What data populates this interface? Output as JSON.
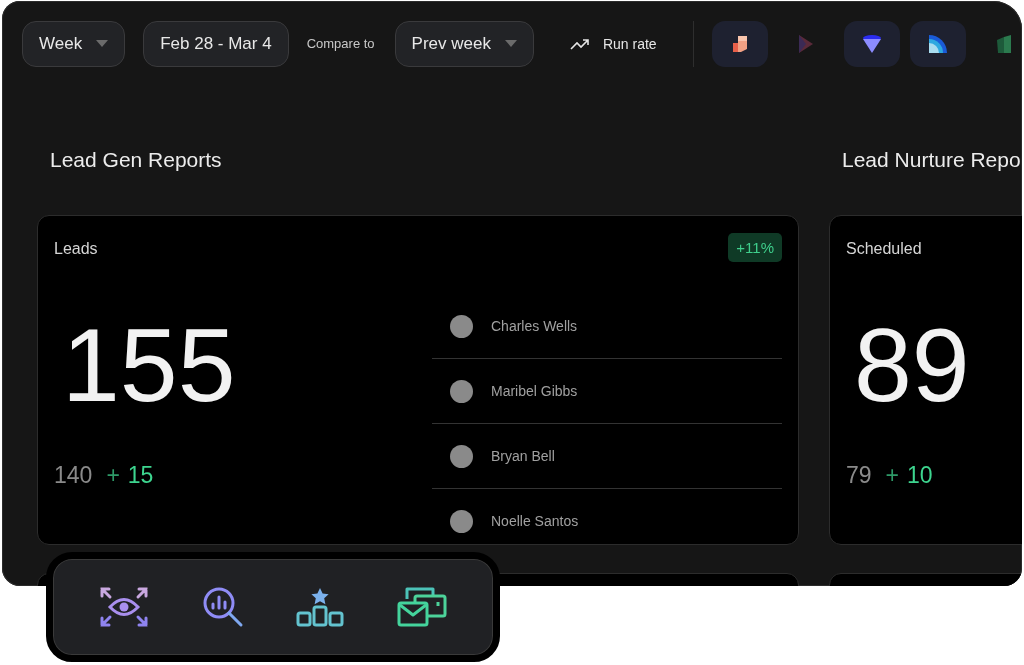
{
  "filters": {
    "period": "Week",
    "date_range": "Feb 28 - Mar 4",
    "compare_label": "Compare to",
    "compare": "Prev week",
    "run_rate": "Run rate"
  },
  "integrations": [
    {
      "kind": "blocks",
      "highlighted": true
    },
    {
      "kind": "chevron",
      "highlighted": false
    },
    {
      "kind": "funnel",
      "highlighted": true
    },
    {
      "kind": "arc",
      "highlighted": true
    },
    {
      "kind": "bars",
      "highlighted": false
    }
  ],
  "sections": [
    {
      "title": "Lead Gen Reports",
      "cards": [
        {
          "label": "Leads",
          "value": "155",
          "previous": "140",
          "delta_sign": "+",
          "delta": "15",
          "badge": "+11%",
          "people": [
            {
              "name": "Charles Wells"
            },
            {
              "name": "Maribel Gibbs"
            },
            {
              "name": "Bryan Bell"
            },
            {
              "name": "Noelle Santos"
            }
          ]
        }
      ]
    },
    {
      "title": "Lead Nurture Repo",
      "cards": [
        {
          "label": "Scheduled",
          "value": "89",
          "previous": "79",
          "delta_sign": "+",
          "delta": "10"
        }
      ]
    }
  ],
  "dock": [
    {
      "kind": "eye"
    },
    {
      "kind": "search-chart"
    },
    {
      "kind": "ranking"
    },
    {
      "kind": "mail"
    }
  ]
}
